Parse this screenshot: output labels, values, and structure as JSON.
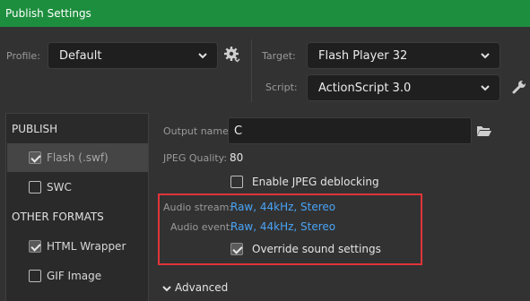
{
  "window": {
    "title": "Publish Settings"
  },
  "profile": {
    "label": "Profile:",
    "value": "Default",
    "gear_icon": "gear-icon"
  },
  "target": {
    "label": "Target:",
    "value": "Flash Player 32"
  },
  "script": {
    "label": "Script:",
    "value": "ActionScript 3.0",
    "wrench_icon": "wrench-icon"
  },
  "sidebar": {
    "publish_header": "PUBLISH",
    "other_header": "OTHER FORMATS",
    "items": [
      {
        "label": "Flash (.swf)",
        "checked": true,
        "selected": true
      },
      {
        "label": "SWC",
        "checked": false,
        "selected": false
      },
      {
        "label": "HTML Wrapper",
        "checked": true,
        "selected": false
      },
      {
        "label": "GIF Image",
        "checked": false,
        "selected": false
      }
    ]
  },
  "output": {
    "label": "Output name:",
    "value": "C",
    "folder_icon": "folder-icon"
  },
  "jpeg": {
    "label": "JPEG Quality:",
    "value": "80",
    "deblock_label": "Enable JPEG deblocking",
    "deblock_checked": false
  },
  "audio": {
    "stream_label": "Audio stream:",
    "stream_value": "Raw, 44kHz, Stereo",
    "event_label": "Audio event:",
    "event_value": "Raw, 44kHz, Stereo",
    "override_label": "Override sound settings",
    "override_checked": true
  },
  "advanced": {
    "label": "Advanced"
  },
  "colors": {
    "titlebar": "#1d8e3e",
    "link": "#4aa3f5",
    "highlight_box": "#e0353a"
  }
}
